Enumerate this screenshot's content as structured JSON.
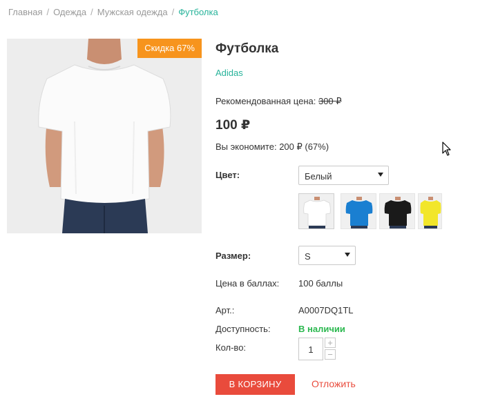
{
  "breadcrumb": {
    "items": [
      "Главная",
      "Одежда",
      "Мужская одежда"
    ],
    "current": "Футболка",
    "separator": "/"
  },
  "product": {
    "discount_badge": "Скидка 67%",
    "title": "Футболка",
    "brand": "Adidas",
    "rec_price_label": "Рекомендованная цена:",
    "rec_price_value": "300 ₽",
    "price": "100 ₽",
    "savings": "Вы экономите: 200 ₽ (67%)"
  },
  "options": {
    "color_label": "Цвет:",
    "color_selected": "Белый",
    "swatch_colors": [
      "#ffffff",
      "#1a7fd1",
      "#1a1a1a",
      "#f2e62a"
    ],
    "size_label": "Размер:",
    "size_selected": "S"
  },
  "details": {
    "points_label": "Цена в баллах:",
    "points_value": "100 баллы",
    "sku_label": "Арт.:",
    "sku_value": "A0007DQ1TL",
    "availability_label": "Доступность:",
    "availability_value": "В наличии",
    "qty_label": "Кол-во:",
    "qty_value": "1",
    "qty_plus": "+",
    "qty_minus": "−"
  },
  "actions": {
    "cart_button": "В КОРЗИНУ",
    "later_link": "Отложить"
  },
  "colors": {
    "accent_green": "#27b39a",
    "badge_orange": "#f7941d",
    "button_red": "#e94b3c",
    "in_stock_green": "#2bb84f"
  }
}
